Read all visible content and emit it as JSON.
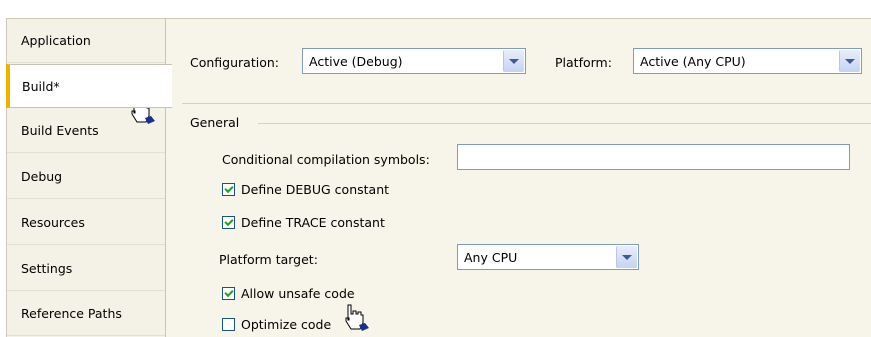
{
  "sidebar": {
    "tabs": [
      {
        "label": "Application"
      },
      {
        "label": "Build*"
      },
      {
        "label": "Build Events"
      },
      {
        "label": "Debug"
      },
      {
        "label": "Resources"
      },
      {
        "label": "Settings"
      },
      {
        "label": "Reference Paths"
      }
    ],
    "active_index": 1
  },
  "header": {
    "configuration_label": "Configuration:",
    "configuration_value": "Active (Debug)",
    "platform_label": "Platform:",
    "platform_value": "Active (Any CPU)"
  },
  "general": {
    "section_title": "General",
    "conditional_label": "Conditional compilation symbols:",
    "conditional_value": "",
    "define_debug_label": "Define DEBUG constant",
    "define_debug_checked": true,
    "define_trace_label": "Define TRACE constant",
    "define_trace_checked": true,
    "platform_target_label": "Platform target:",
    "platform_target_value": "Any CPU",
    "allow_unsafe_label": "Allow unsafe code",
    "allow_unsafe_checked": true,
    "optimize_label": "Optimize code",
    "optimize_checked": false
  },
  "colors": {
    "active_tab_accent": "#f0b000",
    "combo_border": "#7f9db9",
    "check_mark": "#21a121"
  },
  "icons": [
    "hand-cursor-icon",
    "chevron-down-icon",
    "checkmark-icon"
  ]
}
